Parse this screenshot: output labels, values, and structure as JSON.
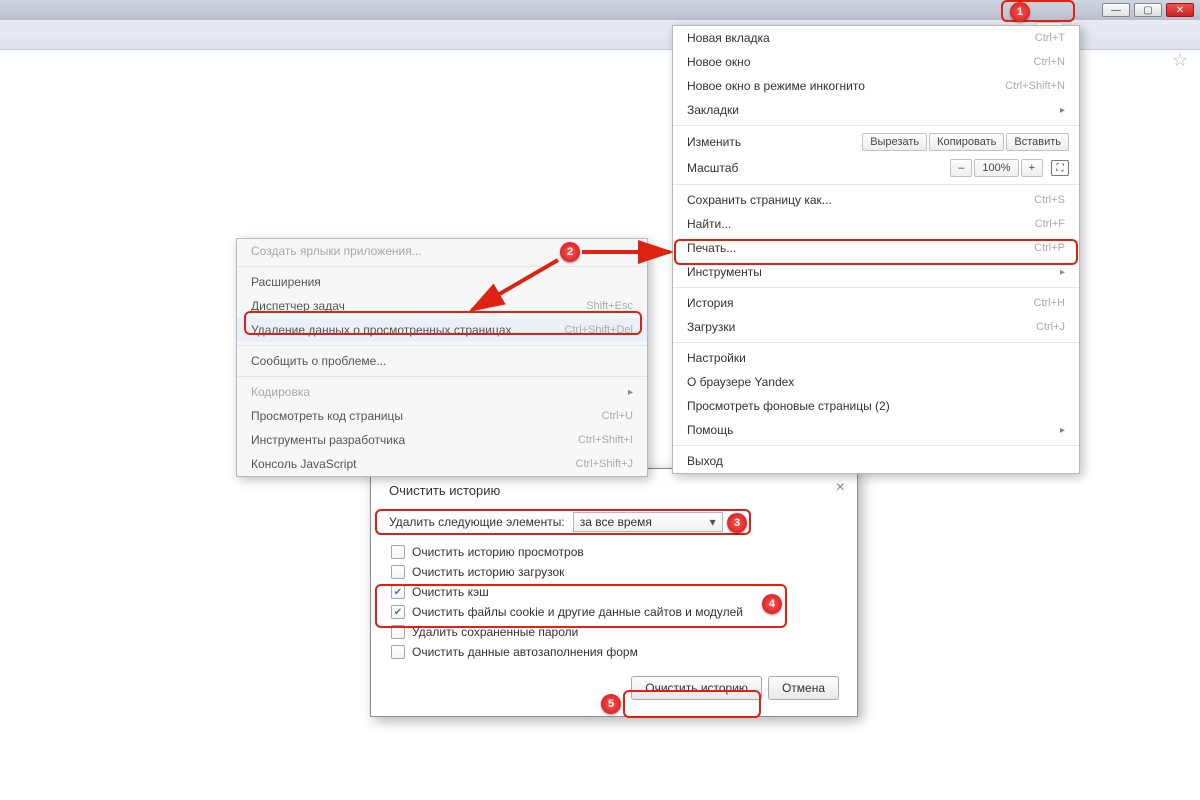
{
  "main_menu": {
    "new_tab": {
      "label": "Новая вкладка",
      "shortcut": "Ctrl+T"
    },
    "new_window": {
      "label": "Новое окно",
      "shortcut": "Ctrl+N"
    },
    "new_incognito": {
      "label": "Новое окно в режиме инкогнито",
      "shortcut": "Ctrl+Shift+N"
    },
    "bookmarks": {
      "label": "Закладки"
    },
    "edit": {
      "label": "Изменить",
      "cut": "Вырезать",
      "copy": "Копировать",
      "paste": "Вставить"
    },
    "zoom": {
      "label": "Масштаб",
      "value": "100%",
      "minus": "–",
      "plus": "+"
    },
    "save_as": {
      "label": "Сохранить страницу как...",
      "shortcut": "Ctrl+S"
    },
    "find": {
      "label": "Найти...",
      "shortcut": "Ctrl+F"
    },
    "print": {
      "label": "Печать...",
      "shortcut": "Ctrl+P"
    },
    "tools": {
      "label": "Инструменты"
    },
    "history": {
      "label": "История",
      "shortcut": "Ctrl+H"
    },
    "downloads": {
      "label": "Загрузки",
      "shortcut": "Ctrl+J"
    },
    "settings": {
      "label": "Настройки"
    },
    "about": {
      "label": "О браузере Yandex"
    },
    "bg_pages": {
      "label": "Просмотреть фоновые страницы (2)"
    },
    "help": {
      "label": "Помощь"
    },
    "exit": {
      "label": "Выход"
    }
  },
  "sub_menu": {
    "create_shortcut": "Создать ярлыки приложения...",
    "extensions": "Расширения",
    "task_mgr": {
      "label": "Диспетчер задач",
      "shortcut": "Shift+Esc"
    },
    "clear_data": {
      "label": "Удаление данных о просмотренных страницах...",
      "shortcut": "Ctrl+Shift+Del"
    },
    "report": "Сообщить о проблеме...",
    "encoding": "Кодировка",
    "view_source": {
      "label": "Просмотреть код страницы",
      "shortcut": "Ctrl+U"
    },
    "dev_tools": {
      "label": "Инструменты разработчика",
      "shortcut": "Ctrl+Shift+I"
    },
    "js_console": {
      "label": "Консоль JavaScript",
      "shortcut": "Ctrl+Shift+J"
    }
  },
  "dialog": {
    "title": "Очистить историю",
    "field_label": "Удалить следующие элементы:",
    "select_value": "за все время",
    "chk": {
      "history": {
        "label": "Очистить историю просмотров",
        "checked": false
      },
      "downloads": {
        "label": "Очистить историю загрузок",
        "checked": false
      },
      "cache": {
        "label": "Очистить кэш",
        "checked": true
      },
      "cookies": {
        "label": "Очистить файлы cookie и другие данные сайтов и модулей",
        "checked": true
      },
      "passwords": {
        "label": "Удалить сохраненные пароли",
        "checked": false
      },
      "autofill": {
        "label": "Очистить данные автозаполнения форм",
        "checked": false
      }
    },
    "ok": "Очистить историю",
    "cancel": "Отмена"
  },
  "callouts": {
    "n1": "1",
    "n2": "2",
    "n3": "3",
    "n4": "4",
    "n5": "5"
  }
}
